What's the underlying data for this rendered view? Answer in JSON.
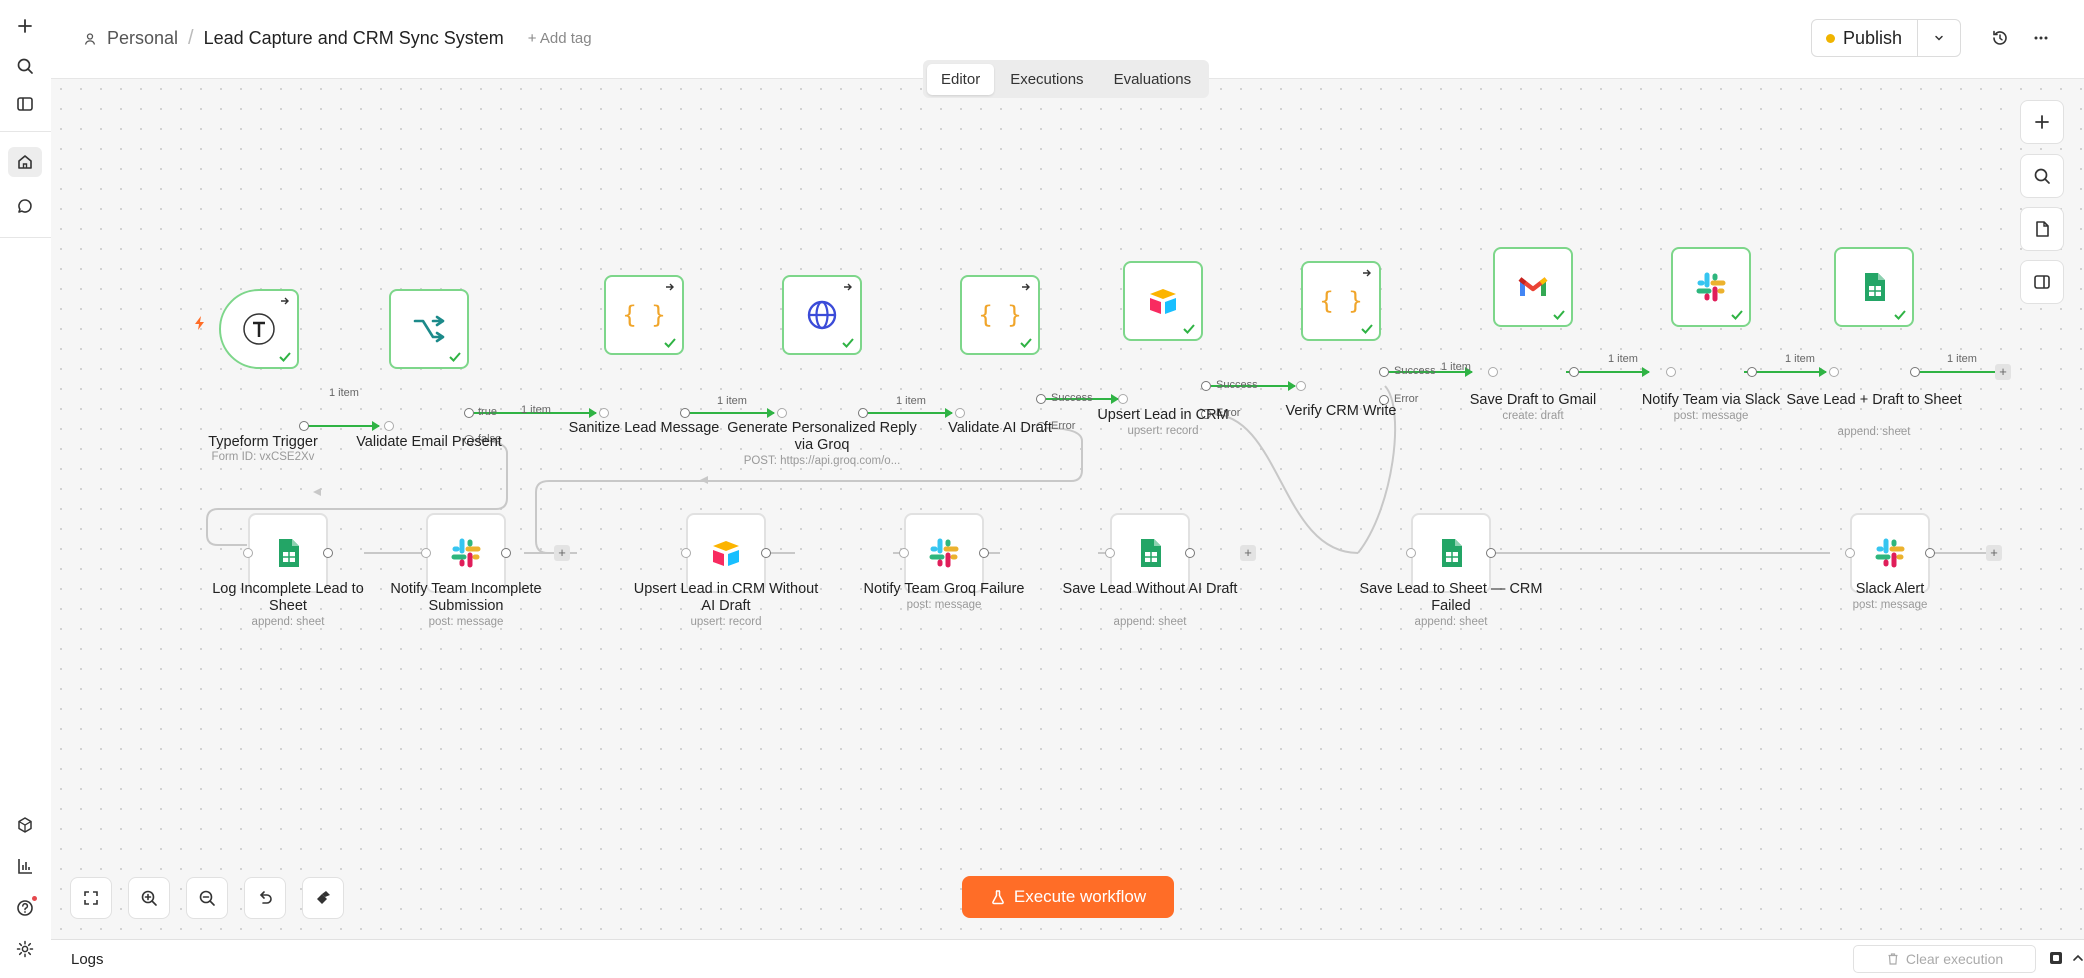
{
  "header": {
    "workspace": "Personal",
    "workflow_title": "Lead Capture and CRM Sync System",
    "add_tag": "+ Add tag",
    "publish_label": "Publish"
  },
  "tabs": [
    {
      "label": "Editor",
      "active": true
    },
    {
      "label": "Executions",
      "active": false
    },
    {
      "label": "Evaluations",
      "active": false
    }
  ],
  "nodes": {
    "typeform": {
      "label": "Typeform Trigger",
      "sub": "Form ID: vxCSE2Xv"
    },
    "validate_email": {
      "label": "Validate Email Present",
      "sub": ""
    },
    "sanitize": {
      "label": "Sanitize Lead Message",
      "sub": ""
    },
    "groq": {
      "label": "Generate Personalized Reply via Groq",
      "sub": "POST: https://api.groq.com/o..."
    },
    "validate_ai": {
      "label": "Validate AI Draft",
      "sub": ""
    },
    "upsert_crm": {
      "label": "Upsert Lead in CRM",
      "sub": "upsert: record"
    },
    "verify_crm": {
      "label": "Verify CRM Write",
      "sub": ""
    },
    "gmail": {
      "label": "Save Draft to Gmail",
      "sub": "create: draft"
    },
    "slack_team": {
      "label": "Notify Team via Slack",
      "sub": "post: message"
    },
    "save_sheet": {
      "label": "Save Lead + Draft to Sheet",
      "sub": "append: sheet"
    },
    "log_incomplete": {
      "label": "Log Incomplete Lead to Sheet",
      "sub": "append: sheet"
    },
    "notify_incomplete": {
      "label": "Notify Team Incomplete Submission",
      "sub": "post: message"
    },
    "upsert_no_ai": {
      "label": "Upsert Lead in CRM Without AI Draft",
      "sub": "upsert: record"
    },
    "notify_groq": {
      "label": "Notify Team Groq Failure",
      "sub": "post: message"
    },
    "save_no_ai": {
      "label": "Save Lead Without AI Draft",
      "sub": "append: sheet"
    },
    "save_crm_failed": {
      "label": "Save Lead to Sheet — CRM Failed",
      "sub": "append: sheet"
    },
    "slack_alert": {
      "label": "Slack Alert",
      "sub": "post: message"
    }
  },
  "edge_labels": {
    "item": "1 item",
    "true": "true",
    "false": "false",
    "success": "Success",
    "error": "Error"
  },
  "execute_label": "Execute workflow",
  "logs": {
    "label": "Logs",
    "clear": "Clear execution"
  },
  "colors": {
    "success": "#2fb344",
    "accent": "#ff6d27",
    "publish_dot": "#f0b400"
  }
}
